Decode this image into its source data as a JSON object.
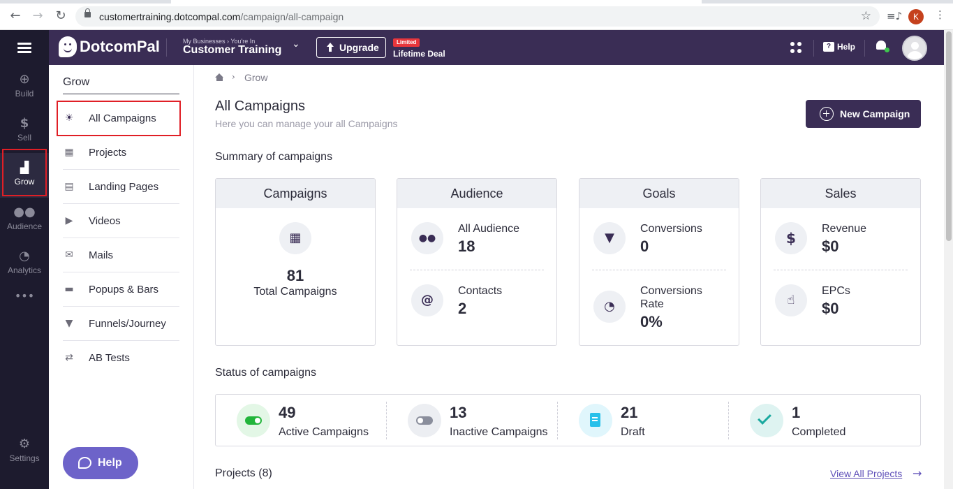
{
  "browser": {
    "url_host": "customertraining.dotcompal.com",
    "url_path": "/campaign/all-campaign",
    "profile_initial": "K"
  },
  "rail": {
    "items": [
      {
        "label": "Build",
        "icon": "plus-circle-icon"
      },
      {
        "label": "Sell",
        "icon": "dollar-icon"
      },
      {
        "label": "Grow",
        "icon": "grow-chart-icon"
      },
      {
        "label": "Audience",
        "icon": "people-icon"
      },
      {
        "label": "Analytics",
        "icon": "pie-icon"
      }
    ],
    "settings_label": "Settings"
  },
  "topbar": {
    "brand": "DotcomPal",
    "business_crumb": "My Businesses › You're In",
    "business_name": "Customer Training",
    "upgrade_label": "Upgrade",
    "limited_badge": "Limited",
    "lifetime_label": "Lifetime Deal",
    "help_label": "Help"
  },
  "subnav": {
    "title": "Grow",
    "items": [
      {
        "label": "All Campaigns",
        "icon": "bulb-icon"
      },
      {
        "label": "Projects",
        "icon": "projects-icon"
      },
      {
        "label": "Landing Pages",
        "icon": "landing-pages-icon"
      },
      {
        "label": "Videos",
        "icon": "video-icon"
      },
      {
        "label": "Mails",
        "icon": "mail-icon"
      },
      {
        "label": "Popups & Bars",
        "icon": "popup-icon"
      },
      {
        "label": "Funnels/Journey",
        "icon": "funnel-icon"
      },
      {
        "label": "AB Tests",
        "icon": "ab-test-icon"
      }
    ],
    "help_button": "Help"
  },
  "main": {
    "breadcrumb": "Grow",
    "title": "All Campaigns",
    "subtitle": "Here you can manage your all Campaigns",
    "new_campaign_label": "New Campaign",
    "summary_title": "Summary of campaigns",
    "cards": {
      "campaigns": {
        "header": "Campaigns",
        "value": "81",
        "caption": "Total Campaigns"
      },
      "audience": {
        "header": "Audience",
        "m1_label": "All Audience",
        "m1_value": "18",
        "m2_label": "Contacts",
        "m2_value": "2"
      },
      "goals": {
        "header": "Goals",
        "m1_label": "Conversions",
        "m1_value": "0",
        "m2_label_line1": "Conversions",
        "m2_label_line2": "Rate",
        "m2_value": "0%"
      },
      "sales": {
        "header": "Sales",
        "m1_label": "Revenue",
        "m1_value": "$0",
        "m2_label": "EPCs",
        "m2_value": "$0"
      }
    },
    "status_title": "Status of campaigns",
    "status": [
      {
        "value": "49",
        "label": "Active Campaigns"
      },
      {
        "value": "13",
        "label": "Inactive Campaigns"
      },
      {
        "value": "21",
        "label": "Draft"
      },
      {
        "value": "1",
        "label": "Completed"
      }
    ],
    "projects_title": "Projects (8)",
    "view_all_label": "View All Projects"
  },
  "colors": {
    "brand_dark": "#3a2d55",
    "rail_bg": "#1d1b2e",
    "highlight_red": "#e01f26",
    "active_green": "#22b53b",
    "draft_blue": "#27c0ea",
    "complete_teal": "#1aa99f",
    "help_fab": "#6d63c9"
  }
}
